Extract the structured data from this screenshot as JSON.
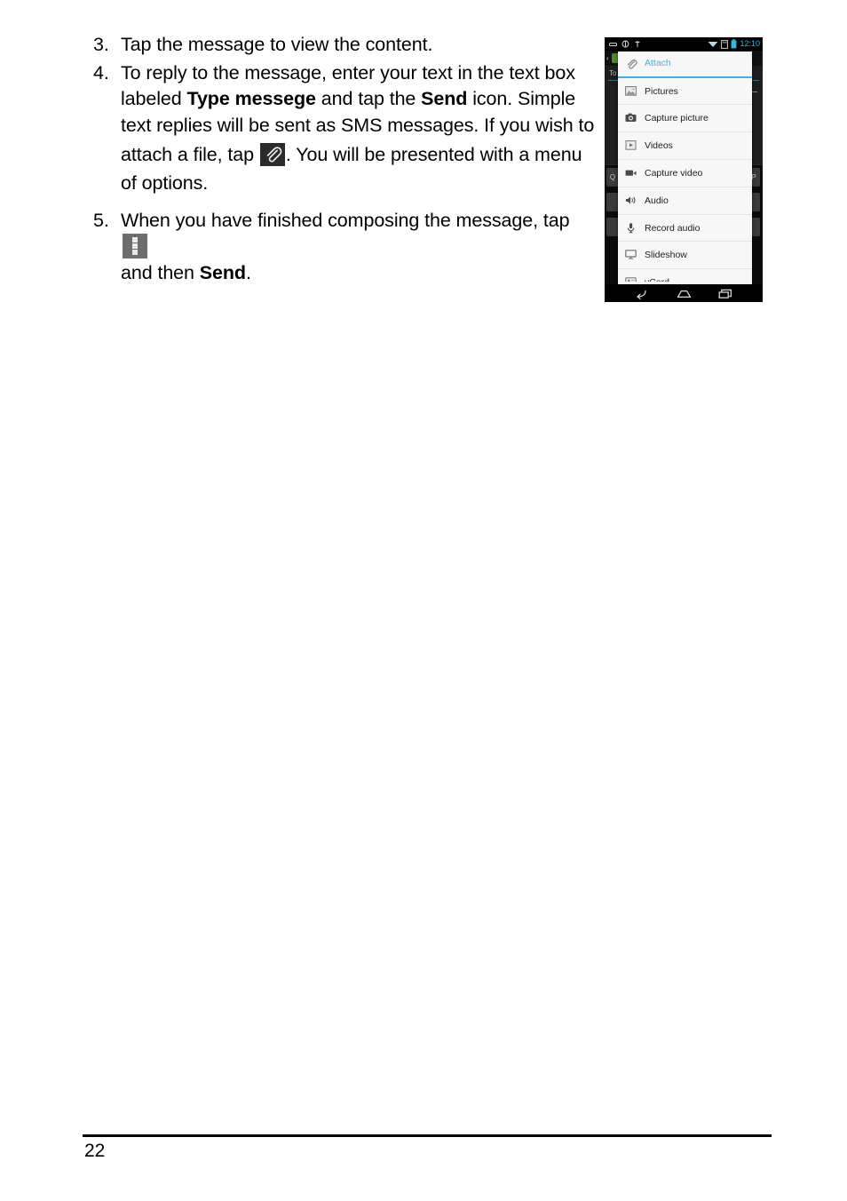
{
  "document": {
    "page_number": "22",
    "steps": [
      {
        "number": "3.",
        "lines": [
          {
            "text": "Tap the message to view the content."
          }
        ]
      },
      {
        "number": "4.",
        "lines": [
          {
            "text": "To reply to the message, enter your text in the text box"
          },
          {
            "pre": "labeled ",
            "bold": "Type messege",
            "mid": " and tap the ",
            "bold2": "Send",
            "post": " icon. Simple"
          },
          {
            "text": "text replies will be sent as SMS messages. If you wish to"
          },
          {
            "pre": "attach a file, tap ",
            "icon": "attach-paperclip-icon",
            "post": ". You will be presented with a menu"
          },
          {
            "text": "of options."
          }
        ]
      },
      {
        "number": "5.",
        "lines": [
          {
            "pre": "When you have finished composing the message, tap ",
            "icon": "overflow-menu-icon"
          },
          {
            "pre": "and then ",
            "bold": "Send",
            "post": "."
          }
        ]
      }
    ]
  },
  "phone": {
    "statusbar": {
      "time": "12:10",
      "left_icons": [
        "usb-icon",
        "sync-icon",
        "debug-icon"
      ],
      "right_icons": [
        "wifi-icon",
        "sd-card-icon",
        "battery-icon"
      ]
    },
    "app": {
      "to_label": "To",
      "keyboard_keys_visible": [
        "Q",
        "P"
      ]
    },
    "dialog": {
      "header": {
        "label": "Attach",
        "icon": "paperclip-icon"
      },
      "items": [
        {
          "label": "Pictures",
          "icon": "image-icon"
        },
        {
          "label": "Capture picture",
          "icon": "camera-icon"
        },
        {
          "label": "Videos",
          "icon": "video-file-icon"
        },
        {
          "label": "Capture video",
          "icon": "camcorder-icon"
        },
        {
          "label": "Audio",
          "icon": "speaker-icon"
        },
        {
          "label": "Record audio",
          "icon": "microphone-icon"
        },
        {
          "label": "Slideshow",
          "icon": "slideshow-icon"
        },
        {
          "label": "vCard",
          "icon": "contact-card-icon"
        }
      ]
    },
    "navbar": {
      "buttons": [
        "back-icon",
        "home-icon",
        "recents-icon"
      ]
    }
  },
  "colors": {
    "holo_blue": "#33b5e5",
    "dialog_bg": "#f7f7f7",
    "chip_dark": "#2b2b2b",
    "chip_gray": "#6e6e6e"
  }
}
